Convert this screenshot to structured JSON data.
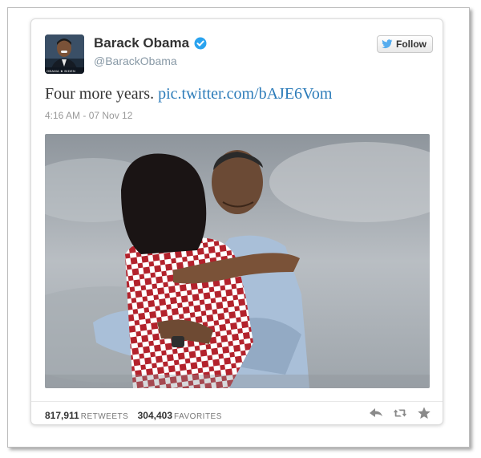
{
  "tweet": {
    "author_name": "Barack Obama",
    "author_handle": "@BarackObama",
    "follow_label": "Follow",
    "text": "Four more years.",
    "link_text": "pic.twitter.com/bAJE6Vom",
    "timestamp": "4:16 AM - 07 Nov 12",
    "retweets": "817,911",
    "retweets_label": "RETWEETS",
    "favorites": "304,403",
    "favorites_label": "FAVORITES",
    "avatar_caption": "OBAMA ★ BIDEN"
  },
  "colors": {
    "link": "#2b7bb9",
    "verified": "#2aa3ef",
    "twitter_bird": "#55acee"
  },
  "icons": {
    "reply": "reply-icon",
    "retweet": "retweet-icon",
    "favorite": "star-icon",
    "verified": "verified-badge-icon",
    "follow": "twitter-bird-icon"
  }
}
